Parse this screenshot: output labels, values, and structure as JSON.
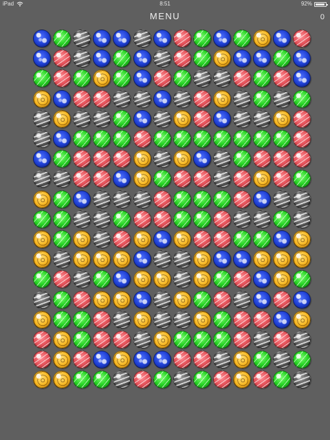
{
  "status_bar": {
    "device_label": "iPad",
    "time": "8:51",
    "battery_percent_label": "92%",
    "battery_level": 0.92
  },
  "header": {
    "menu_label": "MENU",
    "score_value": "0"
  },
  "palette": {
    "green": "#25d222",
    "red": "#e24f57",
    "yellow": "#f6b51f",
    "blue": "#1d3ed2",
    "black": "#555555",
    "background": "#5f5f5f"
  },
  "board": {
    "rows": [
      [
        "b",
        "g",
        "k",
        "b",
        "b",
        "k",
        "b",
        "r",
        "g",
        "b",
        "g",
        "y",
        "b",
        "r"
      ],
      [
        "b",
        "r",
        "k",
        "b",
        "g",
        "b",
        "k",
        "r",
        "g",
        "y",
        "b",
        "b",
        "g",
        "b"
      ],
      [
        "g",
        "r",
        "g",
        "y",
        "g",
        "b",
        "r",
        "g",
        "k",
        "k",
        "r",
        "g",
        "r",
        "b"
      ],
      [
        "y",
        "b",
        "r",
        "r",
        "k",
        "k",
        "b",
        "k",
        "r",
        "y",
        "k",
        "g",
        "k",
        "g"
      ],
      [
        "k",
        "y",
        "k",
        "k",
        "g",
        "b",
        "k",
        "y",
        "r",
        "b",
        "k",
        "k",
        "y",
        "r"
      ],
      [
        "k",
        "b",
        "g",
        "g",
        "g",
        "r",
        "g",
        "g",
        "g",
        "g",
        "g",
        "g",
        "g",
        "r"
      ],
      [
        "b",
        "g",
        "r",
        "r",
        "r",
        "y",
        "k",
        "y",
        "b",
        "k",
        "g",
        "r",
        "r",
        "r"
      ],
      [
        "k",
        "k",
        "r",
        "r",
        "b",
        "y",
        "g",
        "r",
        "r",
        "k",
        "r",
        "y",
        "r",
        "g"
      ],
      [
        "y",
        "g",
        "b",
        "k",
        "k",
        "k",
        "r",
        "g",
        "g",
        "g",
        "r",
        "b",
        "k",
        "k"
      ],
      [
        "g",
        "g",
        "k",
        "k",
        "g",
        "r",
        "r",
        "g",
        "g",
        "r",
        "k",
        "k",
        "g",
        "k"
      ],
      [
        "y",
        "g",
        "y",
        "k",
        "r",
        "y",
        "b",
        "y",
        "r",
        "r",
        "g",
        "g",
        "b",
        "y"
      ],
      [
        "y",
        "k",
        "y",
        "y",
        "y",
        "b",
        "k",
        "k",
        "y",
        "b",
        "b",
        "y",
        "y",
        "y"
      ],
      [
        "g",
        "r",
        "k",
        "g",
        "b",
        "y",
        "y",
        "k",
        "y",
        "g",
        "r",
        "b",
        "y",
        "g"
      ],
      [
        "k",
        "g",
        "r",
        "y",
        "y",
        "b",
        "k",
        "y",
        "g",
        "r",
        "k",
        "b",
        "r",
        "b"
      ],
      [
        "y",
        "g",
        "g",
        "r",
        "k",
        "y",
        "k",
        "k",
        "y",
        "g",
        "r",
        "r",
        "b",
        "y"
      ],
      [
        "r",
        "y",
        "g",
        "r",
        "r",
        "k",
        "y",
        "g",
        "g",
        "g",
        "r",
        "k",
        "r",
        "k"
      ],
      [
        "r",
        "y",
        "r",
        "b",
        "y",
        "b",
        "b",
        "r",
        "r",
        "k",
        "y",
        "g",
        "k",
        "g"
      ],
      [
        "y",
        "y",
        "g",
        "g",
        "k",
        "r",
        "g",
        "k",
        "g",
        "r",
        "y",
        "r",
        "g",
        "k"
      ]
    ]
  }
}
